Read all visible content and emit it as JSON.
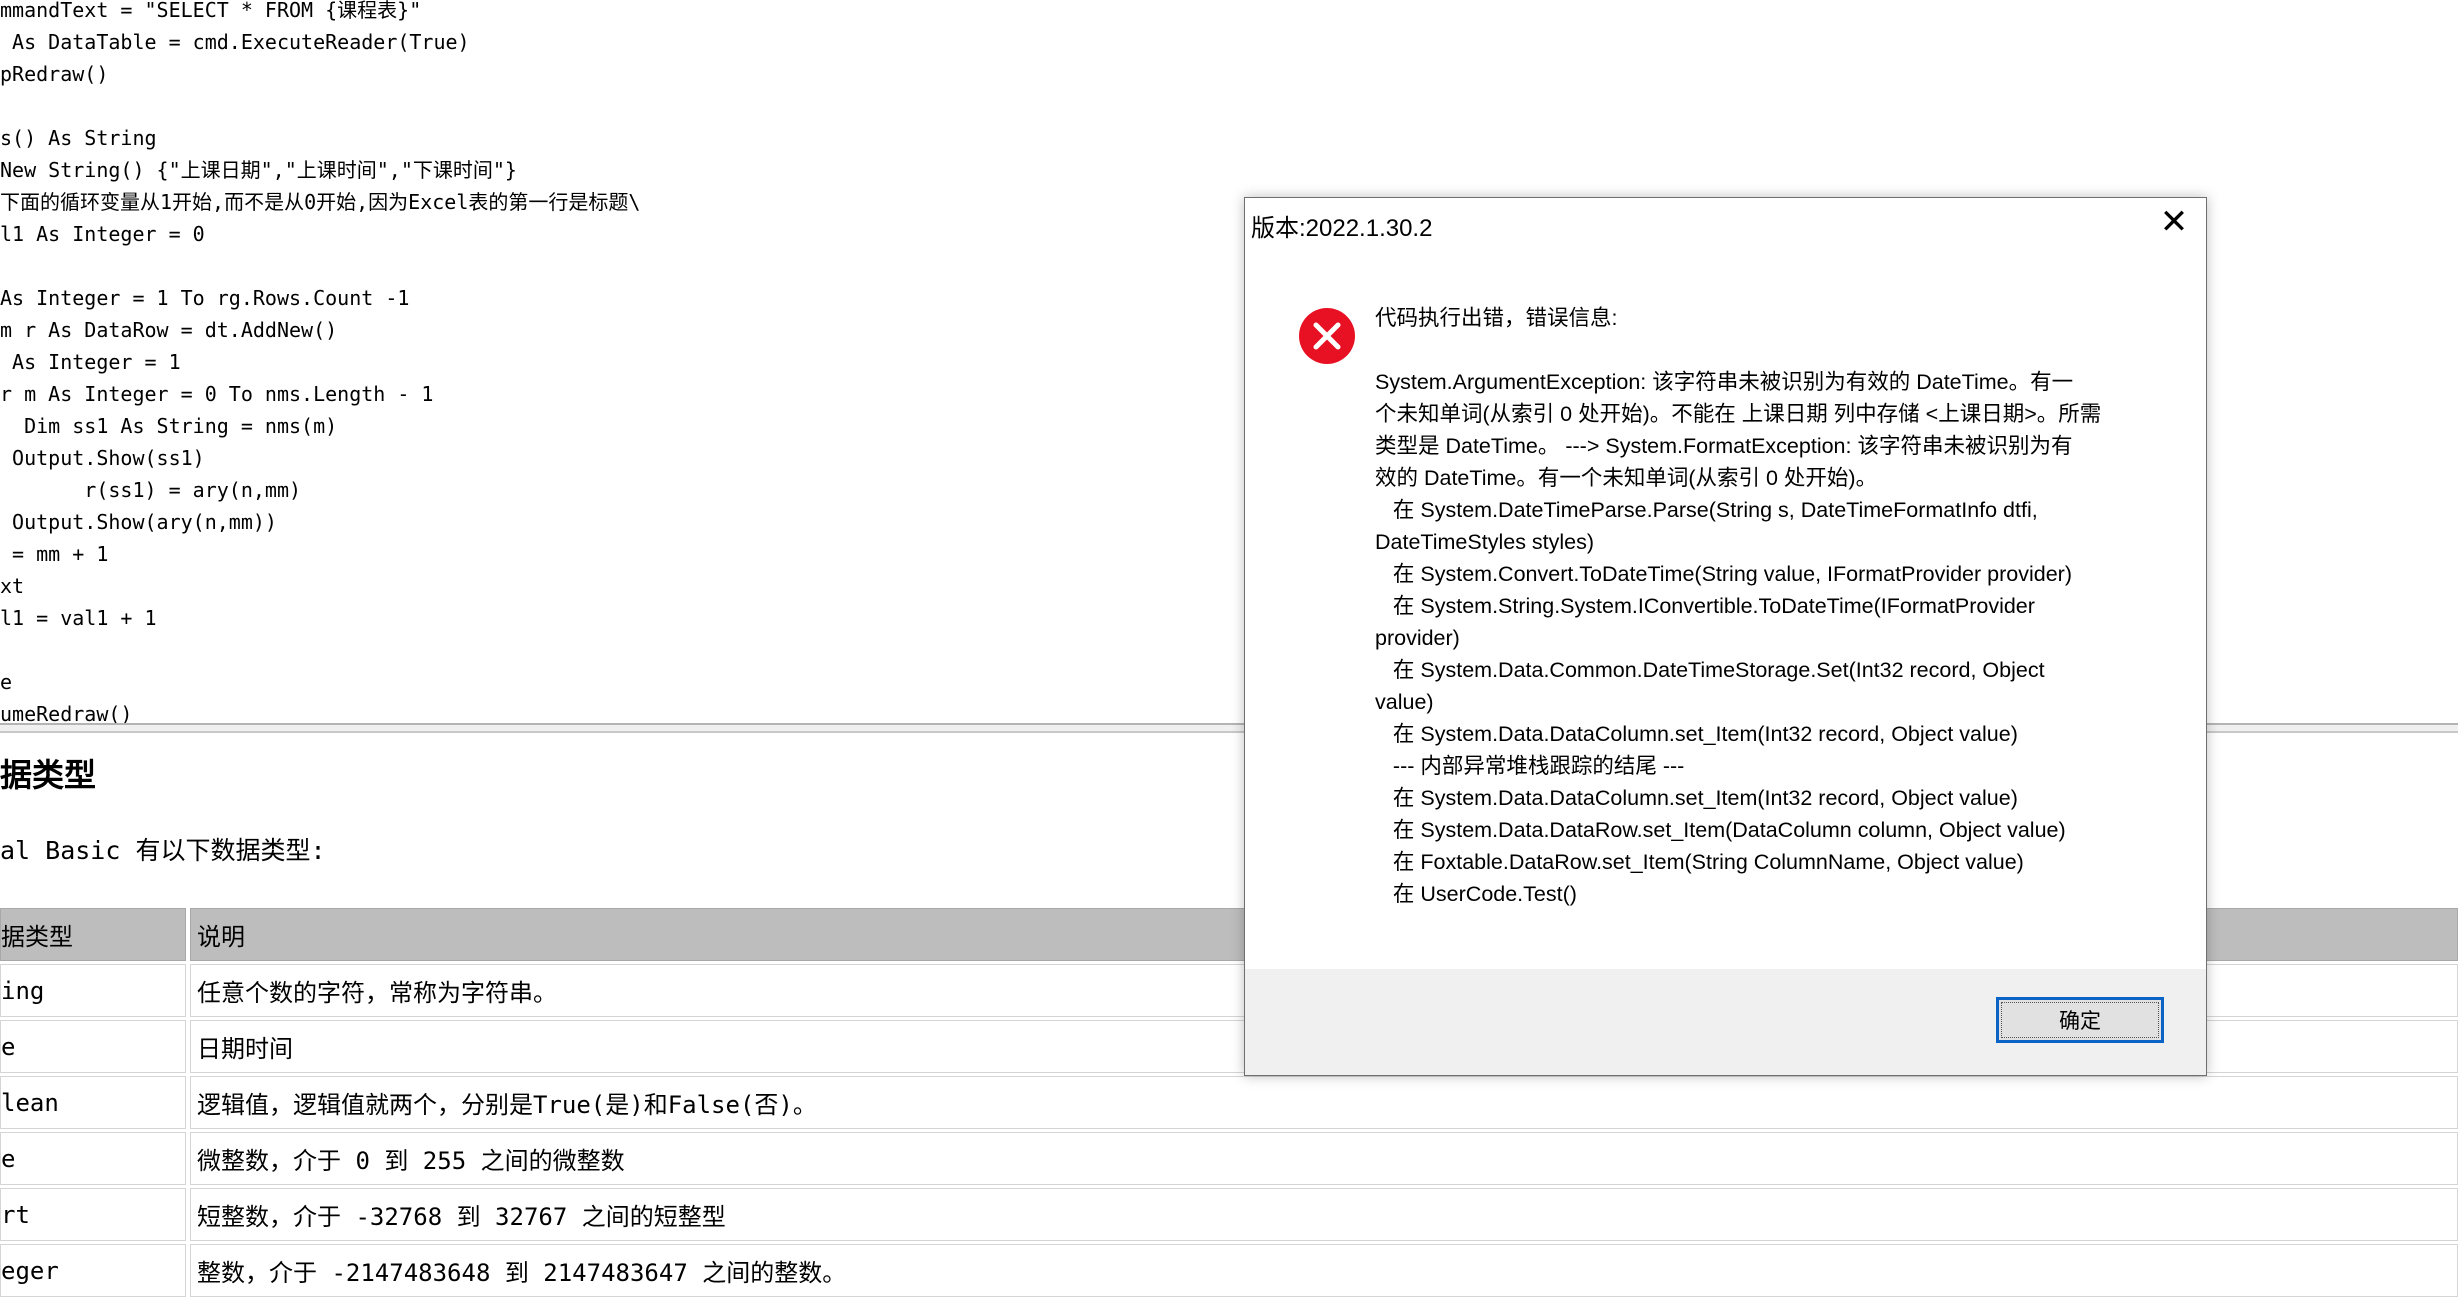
{
  "code_lines": [
    "mmandText = \"SELECT * FROM {课程表}\"",
    " As DataTable = cmd.ExecuteReader(True)",
    "pRedraw()",
    "",
    "s() As String",
    "New String() {\"上课日期\",\"上课时间\",\"下课时间\"}",
    "下面的循环变量从1开始,而不是从0开始,因为Excel表的第一行是标题\\",
    "l1 As Integer = 0",
    "",
    "As Integer = 1 To rg.Rows.Count -1",
    "m r As DataRow = dt.AddNew()",
    " As Integer = 1",
    "r m As Integer = 0 To nms.Length - 1",
    "  Dim ss1 As String = nms(m)",
    " Output.Show(ss1)",
    "       r(ss1) = ary(n,mm)",
    " Output.Show(ary(n,mm))",
    " = mm + 1",
    "xt",
    "l1 = val1 + 1",
    "",
    "e",
    "umeRedraw()"
  ],
  "doc": {
    "heading": "据类型",
    "intro": "al Basic 有以下数据类型:",
    "columns": [
      "据类型",
      "说明"
    ],
    "rows": [
      [
        "ing",
        "任意个数的字符，常称为字符串。"
      ],
      [
        "e",
        "日期时间"
      ],
      [
        "lean",
        "逻辑值，逻辑值就两个，分别是True(是)和False(否)。"
      ],
      [
        "e",
        "微整数，介于 0 到 255 之间的微整数"
      ],
      [
        "rt",
        "短整数，介于 -32768 到 32767 之间的短整型"
      ],
      [
        "eger",
        "整数，介于 -2147483648 到 2147483647 之间的整数。"
      ]
    ]
  },
  "dialog": {
    "title": "版本:2022.1.30.2",
    "close_glyph": "✕",
    "icon": "error-icon",
    "message_lines": [
      "代码执行出错，错误信息:",
      "",
      "System.ArgumentException: 该字符串未被识别为有效的 DateTime。有一",
      "个未知单词(从索引 0 处开始)。不能在 上课日期 列中存储 <上课日期>。所需",
      "类型是 DateTime。 ---> System.FormatException: 该字符串未被识别为有",
      "效的 DateTime。有一个未知单词(从索引 0 处开始)。",
      "   在 System.DateTimeParse.Parse(String s, DateTimeFormatInfo dtfi,",
      "DateTimeStyles styles)",
      "   在 System.Convert.ToDateTime(String value, IFormatProvider provider)",
      "   在 System.String.System.IConvertible.ToDateTime(IFormatProvider",
      "provider)",
      "   在 System.Data.Common.DateTimeStorage.Set(Int32 record, Object",
      "value)",
      "   在 System.Data.DataColumn.set_Item(Int32 record, Object value)",
      "   --- 内部异常堆栈跟踪的结尾 ---",
      "   在 System.Data.DataColumn.set_Item(Int32 record, Object value)",
      "   在 System.Data.DataRow.set_Item(DataColumn column, Object value)",
      "   在 Foxtable.DataRow.set_Item(String ColumnName, Object value)",
      "   在 UserCode.Test()"
    ],
    "ok_label": "确定"
  },
  "colors": {
    "error_red": "#e81123",
    "accent_blue": "#0b63c5",
    "table_header": "#bdbdbd"
  }
}
